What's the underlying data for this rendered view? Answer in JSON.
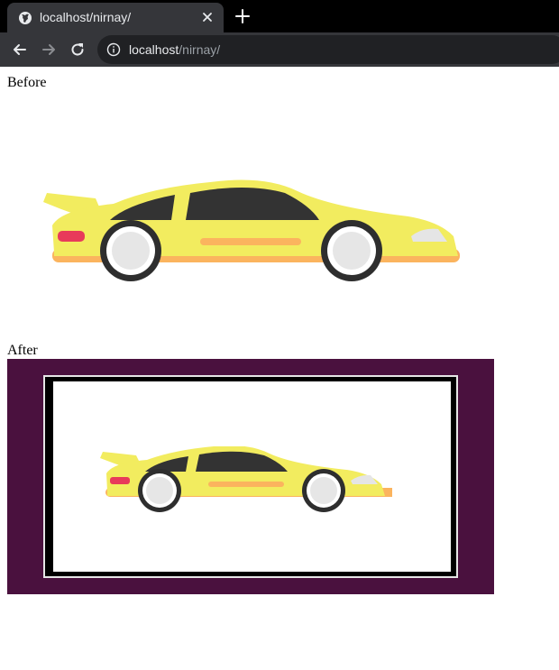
{
  "browser": {
    "tab": {
      "title": "localhost/nirnay/",
      "icon": "globe-icon",
      "close_icon": "close-icon"
    },
    "new_tab_icon": "plus-icon",
    "nav": {
      "back_icon": "arrow-left-icon",
      "forward_icon": "arrow-right-icon",
      "reload_icon": "reload-icon"
    },
    "address_bar": {
      "info_icon": "info-icon",
      "host": "localhost",
      "path": "/nirnay/"
    }
  },
  "page": {
    "before_label": "Before",
    "after_label": "After",
    "before_image": {
      "subject": "yellow sports car"
    },
    "after_image": {
      "subject": "yellow sports car inside black frame",
      "background_color": "#4a113e"
    }
  },
  "colors": {
    "car_body": "#f2ec5f",
    "car_stripe": "#fbb45e",
    "car_window": "#333333",
    "tail_light": "#e83a5a",
    "chrome_dark": "#35363a",
    "tabstrip": "#000000"
  }
}
